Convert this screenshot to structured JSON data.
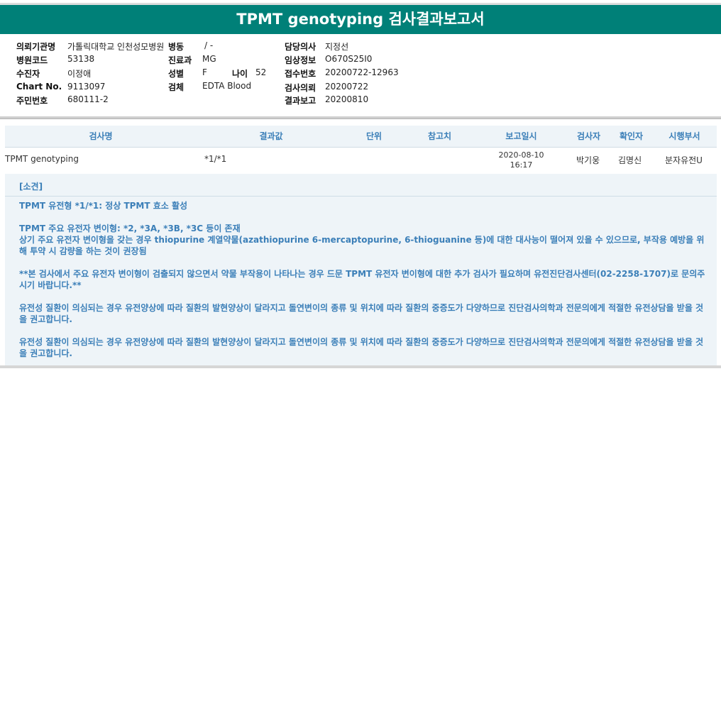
{
  "title": "TPMT genotyping 검사결과보고서",
  "info": {
    "institution_label": "의뢰기관명",
    "institution": "가톨릭대학교 인천성모병원",
    "ward_label": "병동",
    "ward": "/ -",
    "doctor_label": "담당의사",
    "doctor": "지정선",
    "hospital_code_label": "병원코드",
    "hospital_code": "53138",
    "dept_label": "진료과",
    "dept": "MG",
    "clinical_label": "임상정보",
    "clinical": "O670S25I0",
    "patient_label": "수진자",
    "patient": "이정애",
    "sex_label": "성별",
    "sex": "F",
    "age_label": "나이",
    "age": "52",
    "receipt_label": "접수번호",
    "receipt": "20200722-12963",
    "chart_label": "Chart No.",
    "chart": "9113097",
    "specimen_label": "검체",
    "specimen": "EDTA Blood",
    "request_label": "검사의뢰",
    "request": "20200722",
    "rrn_label": "주민번호",
    "rrn": "680111-2",
    "report_label": "결과보고",
    "report": "20200810"
  },
  "table": {
    "headers": [
      "검사명",
      "결과값",
      "단위",
      "참고치",
      "보고일시",
      "검사자",
      "확인자",
      "시행부서"
    ],
    "row": {
      "test": "TPMT genotyping",
      "result": "*1/*1",
      "unit": "",
      "ref": "",
      "date": "2020-08-10",
      "time": "16:17",
      "tester": "박기웅",
      "confirmer": "김명신",
      "dept": "분자유전U"
    }
  },
  "opinion": {
    "title": "[소견]",
    "paragraphs": [
      "TPMT 유전형 *1/*1: 정상 TPMT 효소 활성",
      "TPMT 주요 유전자 변이형: *2, *3A, *3B, *3C 등이 존재\n상기 주요 유전자 변이형을 갖는 경우 thiopurine 계열약물(azathiopurine 6-mercaptopurine, 6-thioguanine 등)에 대한 대사능이 떨어져 있을 수 있으므로, 부작용 예방을 위해 투약 시 감량을 하는 것이 권장됨",
      "**본 검사에서 주요 유전자 변이형이 검출되지 않으면서 약물 부작용이 나타나는 경우 드문 TPMT 유전자 변이형에 대한 추가 검사가 필요하며 유전진단검사센터(02-2258-1707)로 문의주시기 바랍니다.**",
      "유전성 질환이 의심되는 경우 유전양상에 따라 질환의 발현양상이 달라지고 돌연변이의 종류 및 위치에 따라 질환의 중증도가 다양하므로 진단검사의학과 전문의에게 적절한 유전상담을 받을 것을 권고합니다.",
      "유전성 질환이 의심되는 경우 유전양상에 따라 질환의 발현양상이 달라지고 돌연변이의 종류 및 위치에 따라 질환의 중증도가 다양하므로 진단검사의학과 전문의에게 적절한 유전상담을 받을 것을 권고합니다."
    ]
  }
}
